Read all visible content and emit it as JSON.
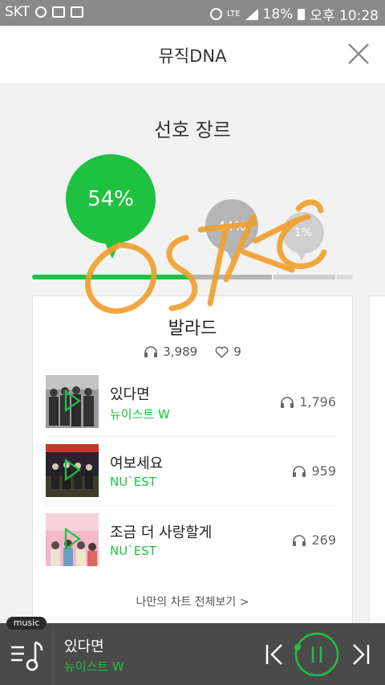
{
  "status_bar": {
    "carrier": "SKT",
    "network": "LTE",
    "battery": "18%",
    "time": "오후 10:28"
  },
  "header": {
    "title": "뮤직DNA"
  },
  "section": {
    "title": "선호 장르"
  },
  "genres": [
    {
      "percent": "54%",
      "color": "#1fc240"
    },
    {
      "percent": "44%",
      "color": "#b5b5b5"
    },
    {
      "percent": "1%",
      "color": "#cfcfcf"
    }
  ],
  "card": {
    "genre": "발라드",
    "plays": "3,989",
    "likes": "9",
    "songs": [
      {
        "title": "있다면",
        "artist": "뉴이스트 W",
        "plays": "1,796"
      },
      {
        "title": "여보세요",
        "artist": "NU`EST",
        "plays": "959"
      },
      {
        "title": "조금 더 사랑할게",
        "artist": "NU`EST",
        "plays": "269"
      }
    ],
    "more_link": "나만의 차트 전체보기 >"
  },
  "player": {
    "badge": "music",
    "now_playing_title": "있다면",
    "now_playing_artist": "뉴이스트 W",
    "progress": 0.1
  },
  "icons": [
    "carrier-icons",
    "alarm-icon",
    "signal-icon",
    "battery-icon",
    "close-icon",
    "headphones-icon",
    "heart-icon",
    "play-overlay-icon",
    "playlist-icon",
    "previous-icon",
    "pause-icon",
    "next-icon"
  ]
}
